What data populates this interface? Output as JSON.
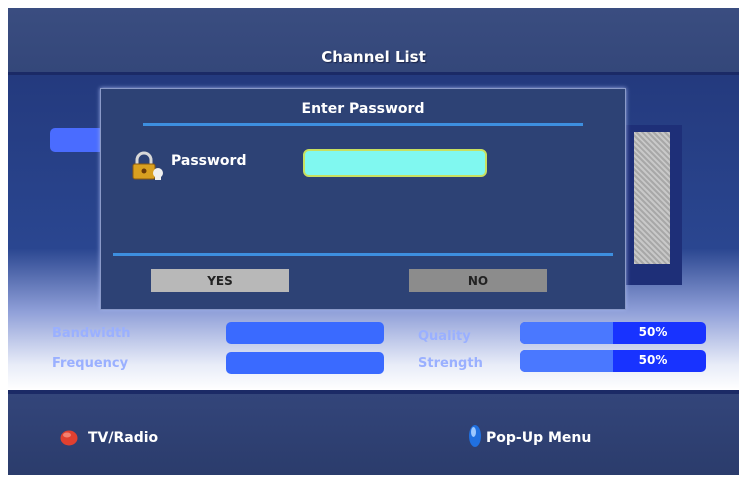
{
  "header": {
    "title": "Channel List"
  },
  "dialog": {
    "title": "Enter Password",
    "password_label": "Password",
    "password_value": "",
    "yes_label": "YES",
    "no_label": "NO"
  },
  "signal": {
    "bandwidth_label": "Bandwidth",
    "frequency_label": "Frequency",
    "quality_label": "Quality",
    "quality_value": "50%",
    "quality_level": 0.5,
    "strength_label": "Strength",
    "strength_value": "50%",
    "strength_level": 0.5
  },
  "footer": {
    "red_button_label": "TV/Radio",
    "blue_button_label": "Pop-Up Menu"
  },
  "colors": {
    "background": "#2d3f6e",
    "accent": "#3d8fe0",
    "input_fill": "#80f8f0",
    "red_key": "#e04030",
    "blue_key": "#2070e0"
  },
  "icons": [
    "lock-icon",
    "red-button-icon",
    "blue-button-icon"
  ]
}
